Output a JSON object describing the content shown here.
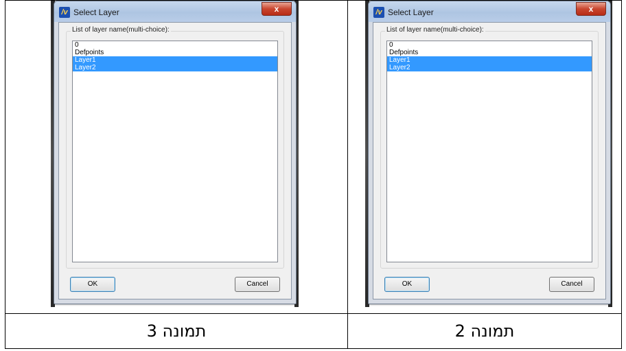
{
  "panels": [
    {
      "dialog": {
        "title": "Select Layer",
        "close_label": "x",
        "app_icon_glyph": "/v",
        "group_label": "List of layer name(multi-choice):",
        "items": [
          {
            "label": "0",
            "selected": false
          },
          {
            "label": "Defpoints",
            "selected": false
          },
          {
            "label": "Layer1",
            "selected": true
          },
          {
            "label": "Layer2",
            "selected": true
          }
        ],
        "ok_label": "OK",
        "cancel_label": "Cancel"
      },
      "caption": "תמונה 3"
    },
    {
      "dialog": {
        "title": "Select Layer",
        "close_label": "x",
        "app_icon_glyph": "/v",
        "group_label": "List of layer name(multi-choice):",
        "items": [
          {
            "label": "0",
            "selected": false
          },
          {
            "label": "Defpoints",
            "selected": false
          },
          {
            "label": "Layer1",
            "selected": true
          },
          {
            "label": "Layer2",
            "selected": true
          }
        ],
        "ok_label": "OK",
        "cancel_label": "Cancel"
      },
      "caption": "תמונה 2"
    }
  ],
  "colors": {
    "selection": "#3399ff",
    "close_button": "#c9452e",
    "titlebar": "#aec5e2"
  }
}
